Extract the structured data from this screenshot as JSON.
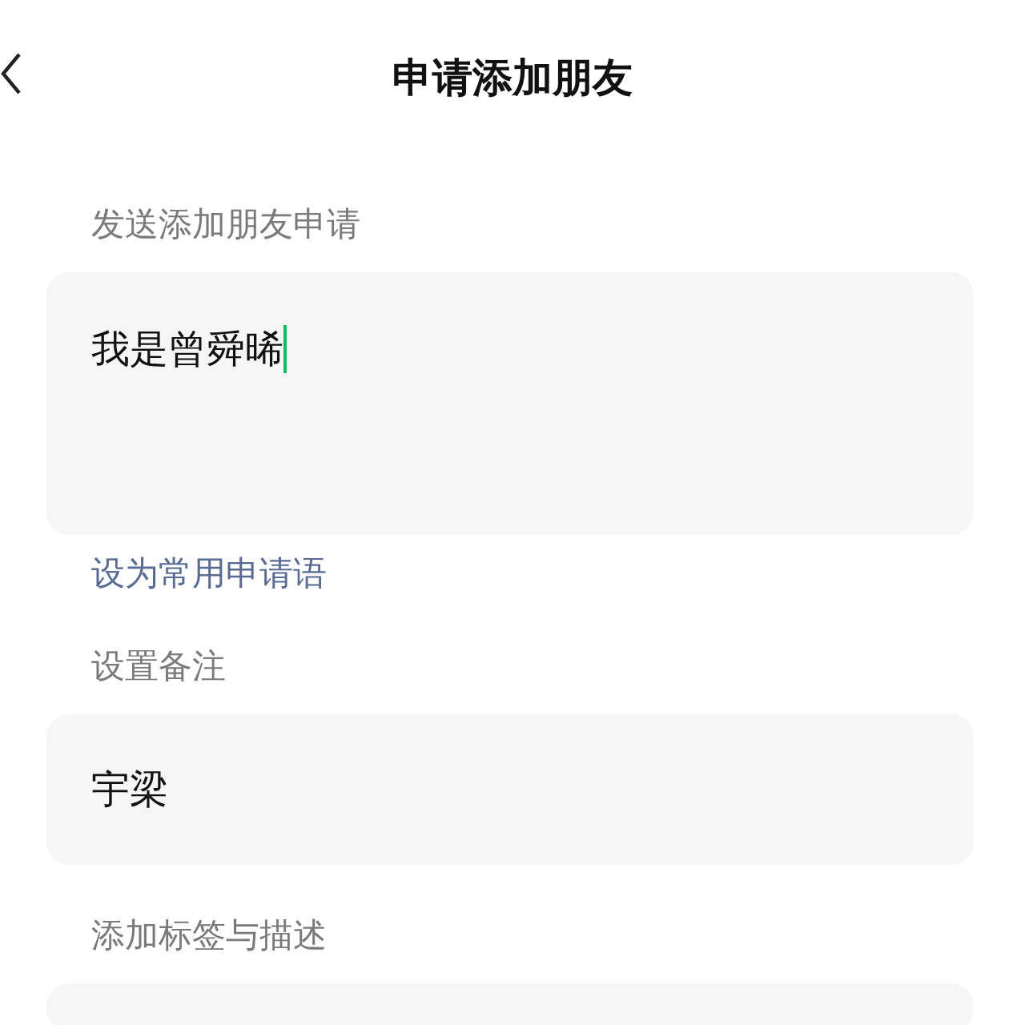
{
  "header": {
    "title": "申请添加朋友"
  },
  "request": {
    "label": "发送添加朋友申请",
    "value": "我是曾舜晞",
    "focused": true,
    "link": "设为常用申请语"
  },
  "remark": {
    "label": "设置备注",
    "value": "宇梁"
  },
  "tags": {
    "label": "添加标签与描述"
  }
}
